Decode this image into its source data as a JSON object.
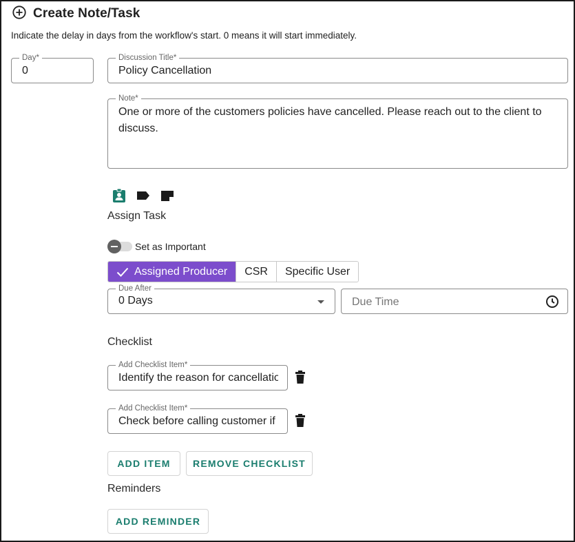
{
  "header": {
    "title": "Create Note/Task",
    "icon": "add-circle-icon"
  },
  "hint": "Indicate the delay in days from the workflow's start. 0 means it will start immediately.",
  "day_field": {
    "label": "Day*",
    "value": "0"
  },
  "title_field": {
    "label": "Discussion Title*",
    "value": "Policy Cancellation"
  },
  "note_field": {
    "label": "Note*",
    "value": "One or more of the customers policies have cancelled. Please reach out to the client to discuss."
  },
  "action_icons": [
    "assign-task-icon",
    "tag-icon",
    "note-icon"
  ],
  "assign_task_label": "Assign Task",
  "important_toggle": {
    "label": "Set as Important",
    "on": false
  },
  "assignee_options": [
    {
      "label": "Assigned Producer",
      "selected": true
    },
    {
      "label": "CSR",
      "selected": false
    },
    {
      "label": "Specific User",
      "selected": false
    }
  ],
  "due_after": {
    "label": "Due After",
    "value": "0 Days"
  },
  "due_time": {
    "placeholder": "Due Time"
  },
  "checklist": {
    "heading": "Checklist",
    "items": [
      {
        "label": "Add Checklist Item*",
        "value": "Identify the reason for cancellation"
      },
      {
        "label": "Add Checklist Item*",
        "value": "Check before calling customer if they have other policies"
      }
    ],
    "add_item_label": "ADD ITEM",
    "remove_label": "REMOVE CHECKLIST"
  },
  "reminders": {
    "heading": "Reminders",
    "add_label": "ADD REMINDER"
  },
  "colors": {
    "accent": "#7C4DCC",
    "teal": "#1A7D6E",
    "icon_teal": "#1B7E6E"
  }
}
